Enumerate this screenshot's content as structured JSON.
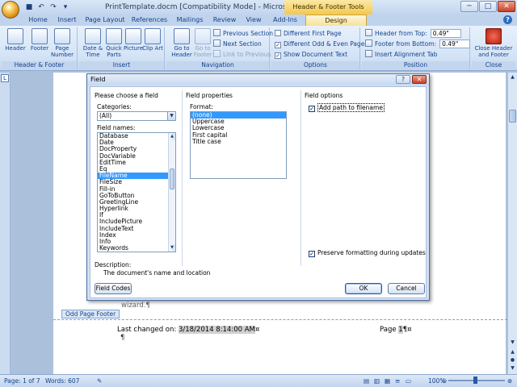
{
  "window": {
    "title": "PrintTemplate.docm [Compatibility Mode] - Microsoft Word",
    "context_tab": "Header & Footer Tools",
    "min": "─",
    "max": "□",
    "close": "✕"
  },
  "ribbon": {
    "tabs": [
      "Home",
      "Insert",
      "Page Layout",
      "References",
      "Mailings",
      "Review",
      "View",
      "Add-Ins",
      "Design"
    ],
    "groups": {
      "header_footer": {
        "label": "Header & Footer",
        "header": "Header",
        "footer": "Footer",
        "page_number": "Page Number"
      },
      "insert": {
        "label": "Insert",
        "date_time": "Date & Time",
        "quick_parts": "Quick Parts",
        "picture": "Picture",
        "clip_art": "Clip Art"
      },
      "navigation": {
        "label": "Navigation",
        "goto_header": "Go to Header",
        "goto_footer": "Go to Footer",
        "previous_section": "Previous Section",
        "next_section": "Next Section",
        "link_to_previous": "Link to Previous"
      },
      "options": {
        "label": "Options",
        "different_first_page": "Different First Page",
        "different_odd_even": "Different Odd & Even Pages",
        "show_document_text": "Show Document Text",
        "different_first_page_checked": false,
        "different_odd_even_checked": true,
        "show_document_text_checked": true
      },
      "position": {
        "label": "Position",
        "header_from_top": "Header from Top:",
        "header_from_top_value": "0.49\"",
        "footer_from_bottom": "Footer from Bottom:",
        "footer_from_bottom_value": "0.49\"",
        "insert_alignment_tab": "Insert Alignment Tab"
      },
      "close": {
        "label": "Close",
        "close_header_footer": "Close Header and Footer"
      }
    }
  },
  "dialog": {
    "title": "Field",
    "help": "?",
    "close": "✕",
    "choose_title": "Please choose a field",
    "categories_label": "Categories:",
    "categories_value": "(All)",
    "field_names_label": "Field names:",
    "field_names": [
      "Database",
      "Date",
      "DocProperty",
      "DocVariable",
      "EditTime",
      "Eq",
      "FileName",
      "FileSize",
      "Fill-in",
      "GoToButton",
      "GreetingLine",
      "Hyperlink",
      "If",
      "IncludePicture",
      "IncludeText",
      "Index",
      "Info",
      "Keywords"
    ],
    "selected_field": "FileName",
    "properties_title": "Field properties",
    "format_label": "Format:",
    "formats": [
      "(none)",
      "Uppercase",
      "Lowercase",
      "First capital",
      "Title case"
    ],
    "selected_format": "(none)",
    "options_title": "Field options",
    "add_path": "Add path to filename",
    "add_path_checked": true,
    "preserve": "Preserve formatting during updates",
    "preserve_checked": true,
    "description_label": "Description:",
    "description_text": "The document's name and location",
    "field_codes_btn": "Field Codes",
    "ok_btn": "OK",
    "cancel_btn": "Cancel"
  },
  "document": {
    "wizard_text": "wizard.¶",
    "footer_tag": "Odd Page Footer",
    "last_changed_prefix": "Last changed on: ",
    "last_changed_value": "3/18/2014 8:14:00 AM",
    "last_changed_mark": "¤",
    "page_label": "Page ",
    "page_value": "1",
    "page_mark": "¶¤",
    "pilcrow": "¶"
  },
  "status": {
    "page": "Page: 1 of 7",
    "words": "Words: 607",
    "zoom": "100%"
  }
}
